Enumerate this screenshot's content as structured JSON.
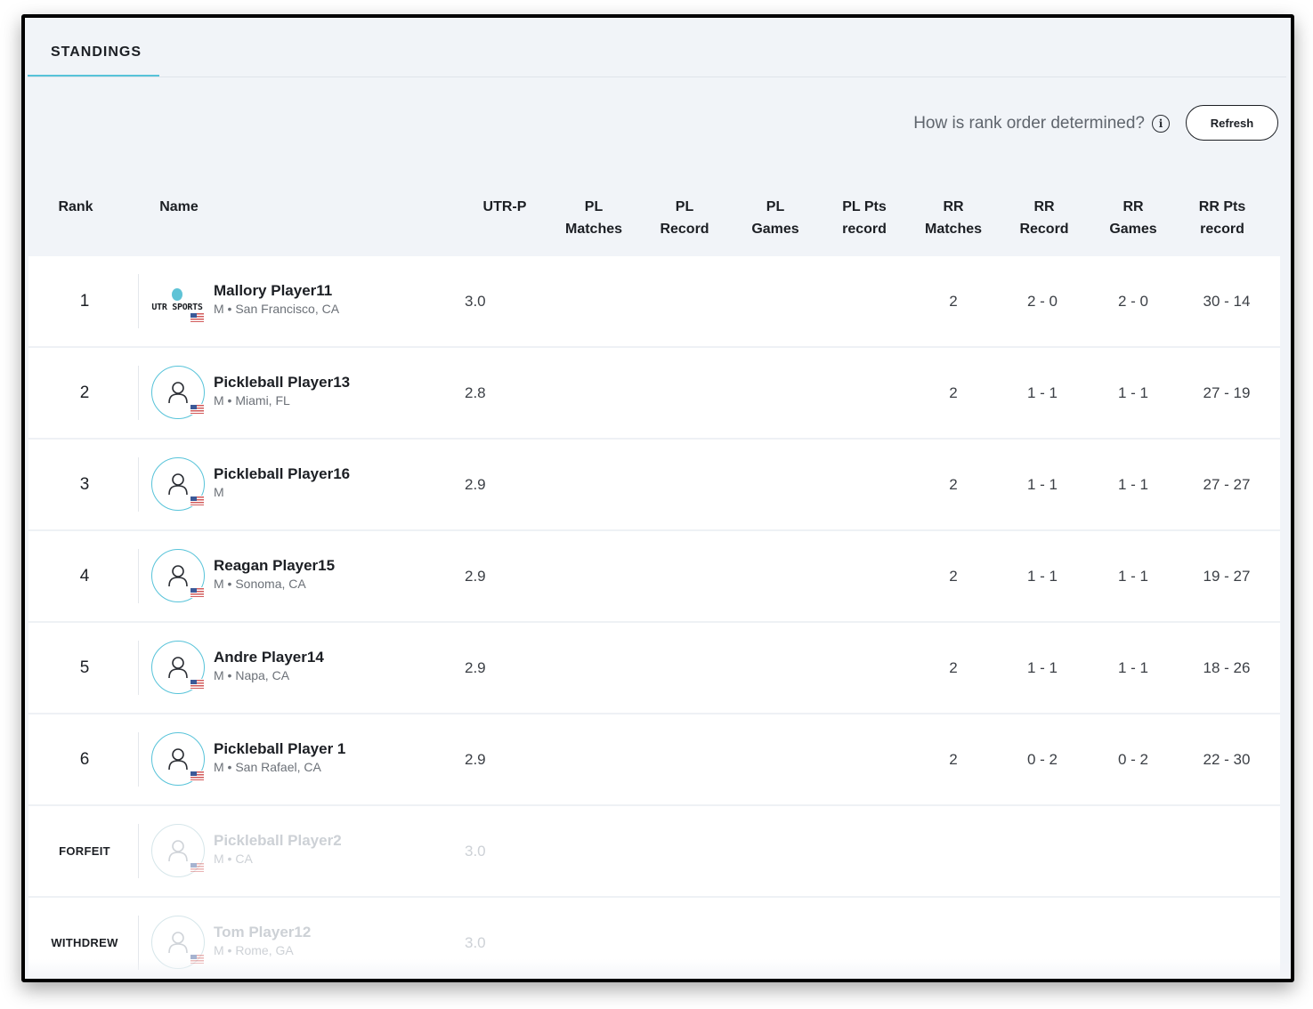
{
  "tabs": {
    "active": "STANDINGS"
  },
  "help": {
    "rank_question": "How is rank order determined?",
    "info_icon": "info-icon"
  },
  "toolbar": {
    "refresh_label": "Refresh"
  },
  "columns": [
    {
      "key": "rank",
      "label": "Rank"
    },
    {
      "key": "name",
      "label": "Name"
    },
    {
      "key": "utr",
      "label": "UTR-P"
    },
    {
      "key": "pl_matches",
      "label": "PL\nMatches"
    },
    {
      "key": "pl_record",
      "label": "PL\nRecord"
    },
    {
      "key": "pl_games",
      "label": "PL\nGames"
    },
    {
      "key": "pl_pts",
      "label": "PL Pts\nrecord"
    },
    {
      "key": "rr_matches",
      "label": "RR\nMatches"
    },
    {
      "key": "rr_record",
      "label": "RR\nRecord"
    },
    {
      "key": "rr_games",
      "label": "RR\nGames"
    },
    {
      "key": "rr_pts",
      "label": "RR Pts\nrecord"
    }
  ],
  "rows": [
    {
      "rank": "1",
      "name": "Mallory Player11",
      "meta": "M • San Francisco, CA",
      "utr": "3.0",
      "rr_matches": "2",
      "rr_record": "2 - 0",
      "rr_games": "2 - 0",
      "rr_pts": "30 - 14",
      "avatar": "utr-sports-logo",
      "logo_text": "UTR SPORTS",
      "faded": false
    },
    {
      "rank": "2",
      "name": "Pickleball Player13",
      "meta": "M • Miami, FL",
      "utr": "2.8",
      "rr_matches": "2",
      "rr_record": "1 - 1",
      "rr_games": "1 - 1",
      "rr_pts": "27 - 19",
      "avatar": "user-icon",
      "faded": false
    },
    {
      "rank": "3",
      "name": "Pickleball Player16",
      "meta": "M",
      "utr": "2.9",
      "rr_matches": "2",
      "rr_record": "1 - 1",
      "rr_games": "1 - 1",
      "rr_pts": "27 - 27",
      "avatar": "user-icon",
      "faded": false
    },
    {
      "rank": "4",
      "name": "Reagan Player15",
      "meta": "M • Sonoma, CA",
      "utr": "2.9",
      "rr_matches": "2",
      "rr_record": "1 - 1",
      "rr_games": "1 - 1",
      "rr_pts": "19 - 27",
      "avatar": "user-icon",
      "faded": false
    },
    {
      "rank": "5",
      "name": "Andre Player14",
      "meta": "M • Napa, CA",
      "utr": "2.9",
      "rr_matches": "2",
      "rr_record": "1 - 1",
      "rr_games": "1 - 1",
      "rr_pts": "18 - 26",
      "avatar": "user-icon",
      "faded": false
    },
    {
      "rank": "6",
      "name": "Pickleball Player 1",
      "meta": "M • San Rafael, CA",
      "utr": "2.9",
      "rr_matches": "2",
      "rr_record": "0 - 2",
      "rr_games": "0 - 2",
      "rr_pts": "22 - 30",
      "avatar": "user-icon",
      "faded": false
    },
    {
      "rank": "FORFEIT",
      "name": "Pickleball Player2",
      "meta": "M • CA",
      "utr": "3.0",
      "rr_matches": "",
      "rr_record": "",
      "rr_games": "",
      "rr_pts": "",
      "avatar": "user-icon",
      "faded": true
    },
    {
      "rank": "WITHDREW",
      "name": "Tom Player12",
      "meta": "M • Rome, GA",
      "utr": "3.0",
      "rr_matches": "",
      "rr_record": "",
      "rr_games": "",
      "rr_pts": "",
      "avatar": "user-icon",
      "faded": true
    }
  ],
  "colors": {
    "accent": "#57c3d9",
    "header_bg": "#f1f4f8",
    "row_bg": "#ffffff"
  }
}
